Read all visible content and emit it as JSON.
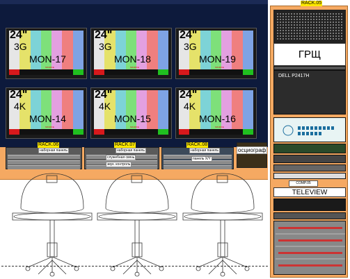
{
  "monitors": [
    {
      "size": "24\"",
      "type": "3G",
      "name": "MON-17",
      "tiny": "SOURCE"
    },
    {
      "size": "24\"",
      "type": "3G",
      "name": "MON-18",
      "tiny": "SOURCE"
    },
    {
      "size": "24\"",
      "type": "3G",
      "name": "MON-19",
      "tiny": "SOURCE"
    },
    {
      "size": "24\"",
      "type": "4K",
      "name": "MON-14",
      "tiny": "SOURCE"
    },
    {
      "size": "24\"",
      "type": "4K",
      "name": "MON-15",
      "tiny": "SOURCE"
    },
    {
      "size": "24\"",
      "type": "4K",
      "name": "MON-16",
      "tiny": "SOURCE"
    }
  ],
  "colors": {
    "bars": [
      "#e6e6e6",
      "#e5e26a",
      "#7dd3d7",
      "#7ee07a",
      "#e3a0e0",
      "#ef7f7f",
      "#7ea3e4"
    ],
    "bottom": [
      "#d7191c",
      "#111111",
      "#111111",
      "#111111",
      "#111111",
      "#111111",
      "#20c020"
    ]
  },
  "racks": {
    "rack06": {
      "label": "RACK.06",
      "panels": [
        "наборная панель"
      ]
    },
    "rack07": {
      "label": "RACK.07",
      "panels": [
        "наборная панель",
        "служебная связь",
        "звук. контроль"
      ]
    },
    "rack08": {
      "label": "RACK.08",
      "panels": [
        "наборная панель",
        "панель X/Y"
      ]
    },
    "osc": "осциограф",
    "rack05": {
      "label": "RACK.05",
      "grsh": "ГРЩ",
      "dell": "DELL P2417H",
      "teleview": "TELEVIEW",
      "comp": "COMP.05"
    }
  }
}
